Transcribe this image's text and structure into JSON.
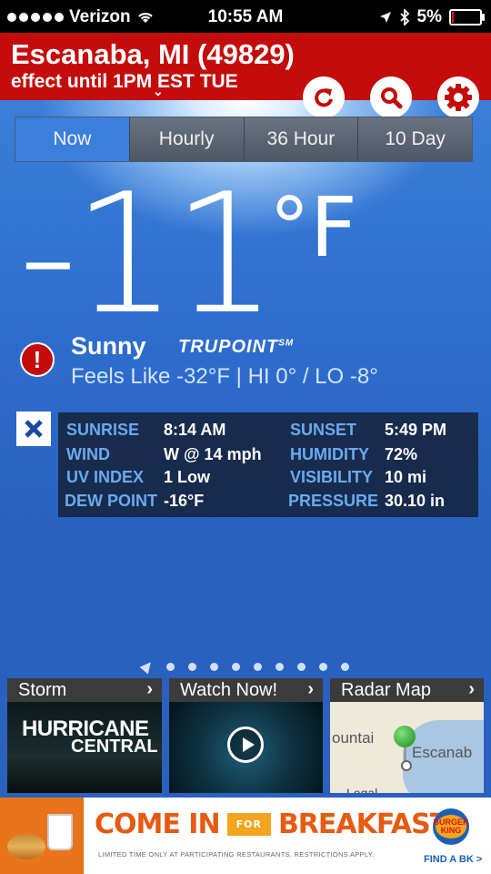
{
  "status_bar": {
    "carrier": "Verizon",
    "time": "10:55 AM",
    "battery": "5%",
    "battery_level": 0.05
  },
  "header": {
    "location": "Escanaba, MI (49829)",
    "alert_text": "effect until 1PM EST TUE",
    "icons": [
      "refresh-icon",
      "search-icon",
      "settings-icon"
    ]
  },
  "tabs": [
    {
      "label": "Now",
      "active": true
    },
    {
      "label": "Hourly",
      "active": false
    },
    {
      "label": "36 Hour",
      "active": false
    },
    {
      "label": "10 Day",
      "active": false
    }
  ],
  "current": {
    "temperature": "-11",
    "unit": "°F",
    "condition": "Sunny",
    "brand": "TRUPOINT",
    "brand_mark": "SM",
    "feels_like": "Feels Like -32°F | HI 0° / LO -8°"
  },
  "details": {
    "sunrise": {
      "label": "SUNRISE",
      "value": "8:14 AM"
    },
    "sunset": {
      "label": "SUNSET",
      "value": "5:49 PM"
    },
    "wind": {
      "label": "WIND",
      "value": "W @ 14 mph"
    },
    "humidity": {
      "label": "HUMIDITY",
      "value": "72%"
    },
    "uv_index": {
      "label": "UV INDEX",
      "value": "1 Low"
    },
    "visibility": {
      "label": "VISIBILITY",
      "value": "10 mi"
    },
    "dew_point": {
      "label": "DEW POINT",
      "value": "-16°F"
    },
    "pressure": {
      "label": "PRESSURE",
      "value": "30.10 in"
    }
  },
  "pager": {
    "pages": 9,
    "current": 1
  },
  "cards": {
    "storm": {
      "title": "Storm",
      "line1": "HURRICANE",
      "line2": "CENTRAL"
    },
    "watch": {
      "title": "Watch Now!"
    },
    "radar": {
      "title": "Radar Map",
      "map_label1": "ountai",
      "map_label2": "Escanab",
      "legal": "Legal"
    }
  },
  "ad": {
    "headline_1": "COME IN",
    "headline_for": "FOR",
    "headline_2": "BREAKFAST",
    "fine_print": "LIMITED TIME ONLY AT PARTICIPATING RESTAURANTS. RESTRICTIONS APPLY.",
    "logo_text": "BURGER KING",
    "cta": "FIND A BK >"
  },
  "colors": {
    "header_red": "#c40c0c",
    "tab_active": "#3d7fdc",
    "label_blue": "#6aaaf0"
  }
}
